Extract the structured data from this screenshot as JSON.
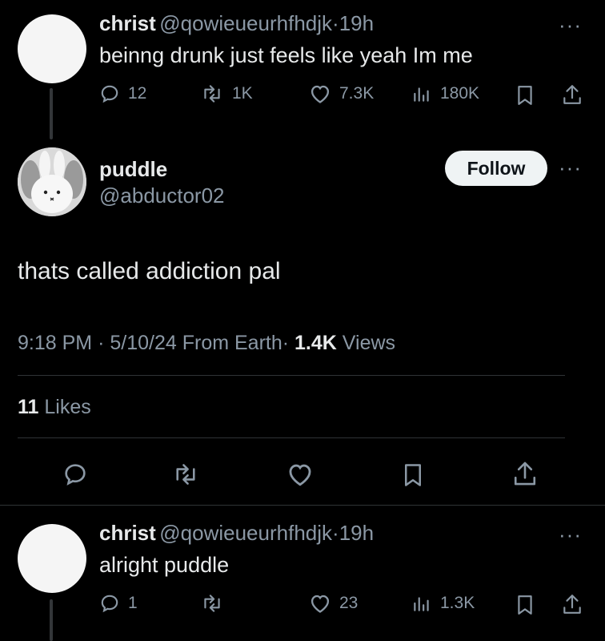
{
  "top_post": {
    "name": "christ",
    "handle": "@qowieueurhfhdjk",
    "time": "19h",
    "text": "beinng drunk just feels like yeah Im me",
    "replies": "12",
    "reposts": "1K",
    "likes": "7.3K",
    "views": "180K"
  },
  "main_post": {
    "name": "puddle",
    "handle": "@abductor02",
    "follow_label": "Follow",
    "text": "thats called addiction pal",
    "time": "9:18 PM",
    "date": "5/10/24",
    "source": "From Earth",
    "views_count": "1.4K",
    "views_label": "Views",
    "likes_count": "11",
    "likes_label": "Likes"
  },
  "reply_post": {
    "name": "christ",
    "handle": "@qowieueurhfhdjk",
    "time": "19h",
    "text": "alright puddle",
    "replies": "1",
    "likes": "23",
    "views": "1.3K"
  },
  "separator": "·",
  "more": "···"
}
